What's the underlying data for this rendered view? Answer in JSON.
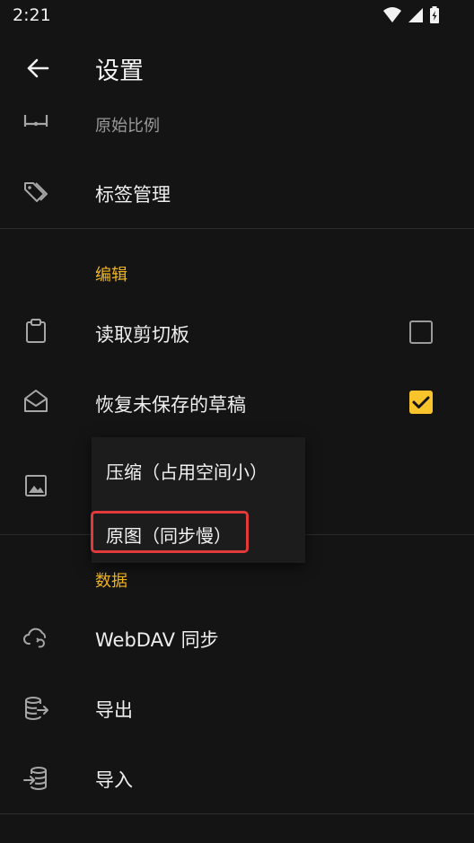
{
  "status": {
    "time": "2:21"
  },
  "app_bar": {
    "title": "设置"
  },
  "rows": {
    "aspect": {
      "subtitle": "原始比例"
    },
    "tags": {
      "label": "标签管理"
    },
    "clipboard": {
      "label": "读取剪切板",
      "checked": false
    },
    "drafts": {
      "label": "恢复未保存的草稿",
      "checked": true
    },
    "webdav": {
      "label": "WebDAV 同步"
    },
    "export": {
      "label": "导出"
    },
    "import": {
      "label": "导入"
    }
  },
  "sections": {
    "edit": "编辑",
    "data": "数据"
  },
  "popup": {
    "options": [
      "压缩（占用空间小）",
      "原图（同步慢）"
    ]
  },
  "colors": {
    "accent": "#f1b41c",
    "checkbox_on": "#f7c42c",
    "highlight": "#e23a3a",
    "background": "#141414"
  }
}
